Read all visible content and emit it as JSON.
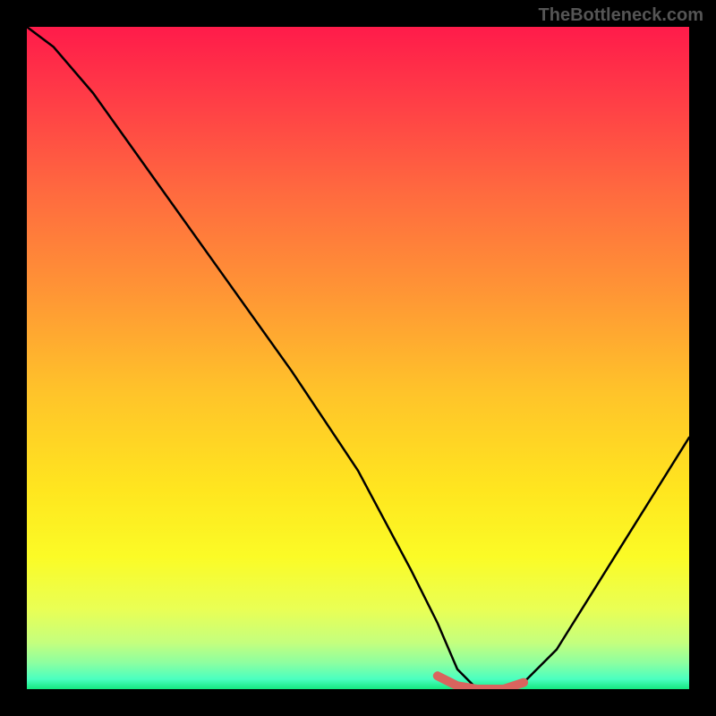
{
  "watermark": "TheBottleneck.com",
  "chart_data": {
    "type": "line",
    "title": "",
    "xlabel": "",
    "ylabel": "",
    "xlim": [
      0,
      100
    ],
    "ylim": [
      0,
      100
    ],
    "series": [
      {
        "name": "bottleneck-curve",
        "x": [
          0,
          4,
          10,
          20,
          30,
          40,
          50,
          58,
          62,
          65,
          68,
          72,
          75,
          80,
          85,
          90,
          95,
          100
        ],
        "y": [
          100,
          97,
          90,
          76,
          62,
          48,
          33,
          18,
          10,
          3,
          0,
          0,
          1,
          6,
          14,
          22,
          30,
          38
        ]
      }
    ],
    "highlight": {
      "name": "optimal-range",
      "x": [
        62,
        65,
        68,
        72,
        75
      ],
      "y": [
        2,
        0.5,
        0,
        0,
        1
      ],
      "color": "#d9645e"
    },
    "gradient_stops": [
      {
        "pos": 0.0,
        "color": "#ff1b4a"
      },
      {
        "pos": 0.1,
        "color": "#ff3a47"
      },
      {
        "pos": 0.25,
        "color": "#ff6a3f"
      },
      {
        "pos": 0.4,
        "color": "#ff9535"
      },
      {
        "pos": 0.55,
        "color": "#ffc32a"
      },
      {
        "pos": 0.7,
        "color": "#ffe61f"
      },
      {
        "pos": 0.8,
        "color": "#fbfb26"
      },
      {
        "pos": 0.88,
        "color": "#e9ff55"
      },
      {
        "pos": 0.93,
        "color": "#c4ff7e"
      },
      {
        "pos": 0.96,
        "color": "#8dffa0"
      },
      {
        "pos": 0.985,
        "color": "#4affc0"
      },
      {
        "pos": 1.0,
        "color": "#15e87f"
      }
    ]
  }
}
